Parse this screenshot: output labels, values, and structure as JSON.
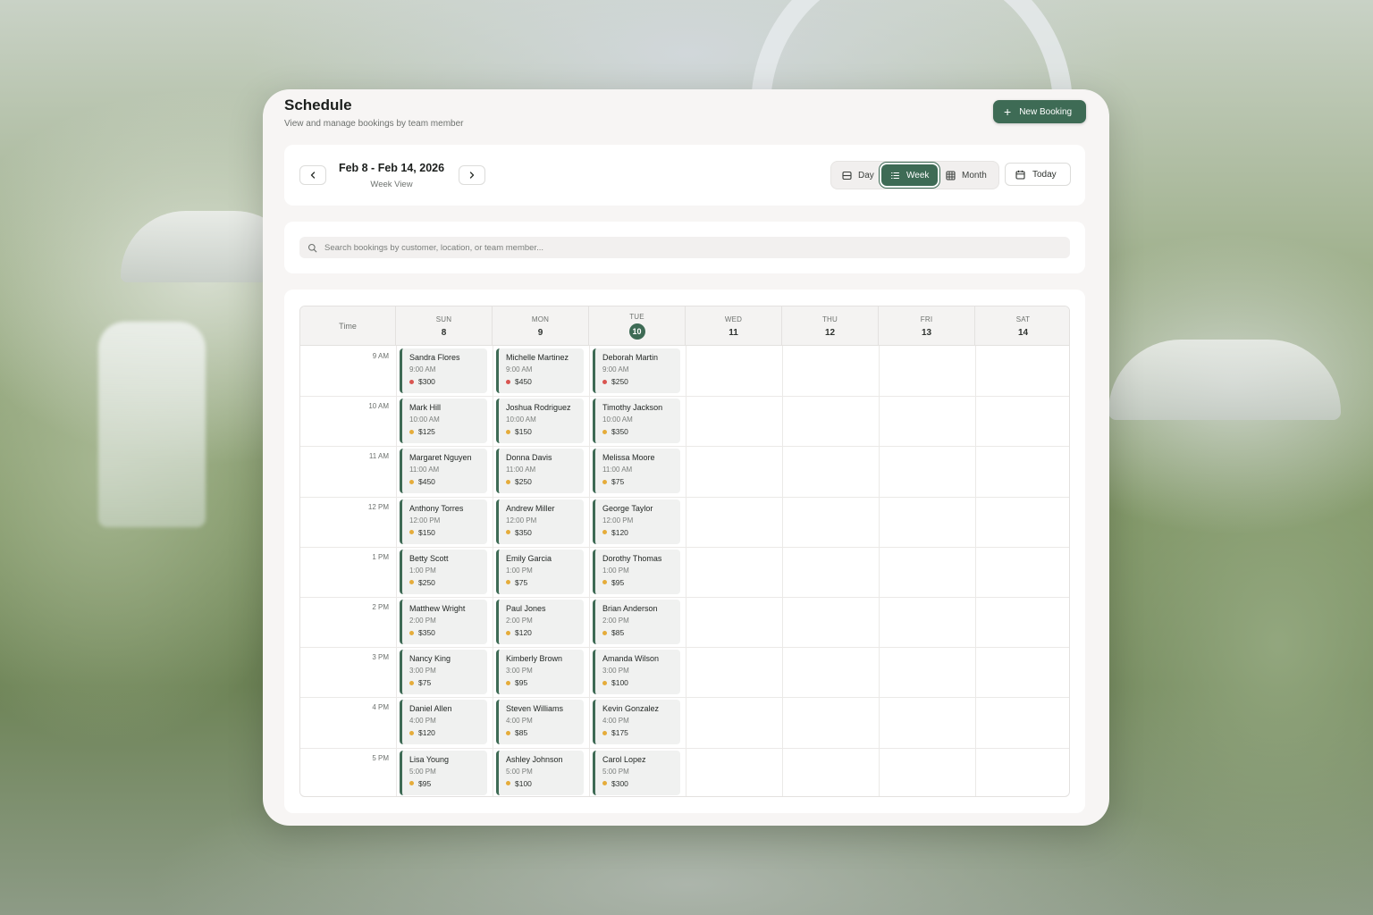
{
  "header": {
    "title": "Schedule",
    "subtitle": "View and manage bookings by team member",
    "new_booking_label": "New Booking"
  },
  "nav": {
    "date_range": "Feb 8 - Feb 14, 2026",
    "view_label": "Week View",
    "views": [
      {
        "label": "Day",
        "icon": "day-view-icon",
        "active": false
      },
      {
        "label": "Week",
        "icon": "list-icon",
        "active": true
      },
      {
        "label": "Month",
        "icon": "grid-icon",
        "active": false
      }
    ],
    "today_label": "Today"
  },
  "search": {
    "placeholder": "Search bookings by customer, location, or team member...",
    "value": ""
  },
  "calendar": {
    "time_header": "Time",
    "days": [
      {
        "name": "SUN",
        "num": "8",
        "today": false
      },
      {
        "name": "MON",
        "num": "9",
        "today": false
      },
      {
        "name": "TUE",
        "num": "10",
        "today": true
      },
      {
        "name": "WED",
        "num": "11",
        "today": false
      },
      {
        "name": "THU",
        "num": "12",
        "today": false
      },
      {
        "name": "FRI",
        "num": "13",
        "today": false
      },
      {
        "name": "SAT",
        "num": "14",
        "today": false
      }
    ],
    "hours": [
      "9 AM",
      "10 AM",
      "11 AM",
      "12 PM",
      "1 PM",
      "2 PM",
      "3 PM",
      "4 PM",
      "5 PM"
    ],
    "bookings": [
      {
        "day": 0,
        "slot": 0,
        "name": "Sandra Flores",
        "time": "9:00 AM",
        "price": "$300",
        "status": "red"
      },
      {
        "day": 1,
        "slot": 0,
        "name": "Michelle Martinez",
        "time": "9:00 AM",
        "price": "$450",
        "status": "red"
      },
      {
        "day": 2,
        "slot": 0,
        "name": "Deborah Martin",
        "time": "9:00 AM",
        "price": "$250",
        "status": "red"
      },
      {
        "day": 0,
        "slot": 1,
        "name": "Mark Hill",
        "time": "10:00 AM",
        "price": "$125",
        "status": "amber"
      },
      {
        "day": 1,
        "slot": 1,
        "name": "Joshua Rodriguez",
        "time": "10:00 AM",
        "price": "$150",
        "status": "amber"
      },
      {
        "day": 2,
        "slot": 1,
        "name": "Timothy Jackson",
        "time": "10:00 AM",
        "price": "$350",
        "status": "amber"
      },
      {
        "day": 0,
        "slot": 2,
        "name": "Margaret Nguyen",
        "time": "11:00 AM",
        "price": "$450",
        "status": "amber"
      },
      {
        "day": 1,
        "slot": 2,
        "name": "Donna Davis",
        "time": "11:00 AM",
        "price": "$250",
        "status": "amber"
      },
      {
        "day": 2,
        "slot": 2,
        "name": "Melissa Moore",
        "time": "11:00 AM",
        "price": "$75",
        "status": "amber"
      },
      {
        "day": 0,
        "slot": 3,
        "name": "Anthony Torres",
        "time": "12:00 PM",
        "price": "$150",
        "status": "amber"
      },
      {
        "day": 1,
        "slot": 3,
        "name": "Andrew Miller",
        "time": "12:00 PM",
        "price": "$350",
        "status": "amber"
      },
      {
        "day": 2,
        "slot": 3,
        "name": "George Taylor",
        "time": "12:00 PM",
        "price": "$120",
        "status": "amber"
      },
      {
        "day": 0,
        "slot": 4,
        "name": "Betty Scott",
        "time": "1:00 PM",
        "price": "$250",
        "status": "amber"
      },
      {
        "day": 1,
        "slot": 4,
        "name": "Emily Garcia",
        "time": "1:00 PM",
        "price": "$75",
        "status": "amber"
      },
      {
        "day": 2,
        "slot": 4,
        "name": "Dorothy Thomas",
        "time": "1:00 PM",
        "price": "$95",
        "status": "amber"
      },
      {
        "day": 0,
        "slot": 5,
        "name": "Matthew Wright",
        "time": "2:00 PM",
        "price": "$350",
        "status": "amber"
      },
      {
        "day": 1,
        "slot": 5,
        "name": "Paul Jones",
        "time": "2:00 PM",
        "price": "$120",
        "status": "amber"
      },
      {
        "day": 2,
        "slot": 5,
        "name": "Brian Anderson",
        "time": "2:00 PM",
        "price": "$85",
        "status": "amber"
      },
      {
        "day": 0,
        "slot": 6,
        "name": "Nancy King",
        "time": "3:00 PM",
        "price": "$75",
        "status": "amber"
      },
      {
        "day": 1,
        "slot": 6,
        "name": "Kimberly Brown",
        "time": "3:00 PM",
        "price": "$95",
        "status": "amber"
      },
      {
        "day": 2,
        "slot": 6,
        "name": "Amanda Wilson",
        "time": "3:00 PM",
        "price": "$100",
        "status": "amber"
      },
      {
        "day": 0,
        "slot": 7,
        "name": "Daniel Allen",
        "time": "4:00 PM",
        "price": "$120",
        "status": "amber"
      },
      {
        "day": 1,
        "slot": 7,
        "name": "Steven Williams",
        "time": "4:00 PM",
        "price": "$85",
        "status": "amber"
      },
      {
        "day": 2,
        "slot": 7,
        "name": "Kevin Gonzalez",
        "time": "4:00 PM",
        "price": "$175",
        "status": "amber"
      },
      {
        "day": 0,
        "slot": 8,
        "name": "Lisa Young",
        "time": "5:00 PM",
        "price": "$95",
        "status": "amber"
      },
      {
        "day": 1,
        "slot": 8,
        "name": "Ashley Johnson",
        "time": "5:00 PM",
        "price": "$100",
        "status": "amber"
      },
      {
        "day": 2,
        "slot": 8,
        "name": "Carol Lopez",
        "time": "5:00 PM",
        "price": "$300",
        "status": "amber"
      }
    ]
  },
  "colors": {
    "accent": "#3e6b55",
    "status_red": "#d95550",
    "status_amber": "#e5ac3a"
  }
}
